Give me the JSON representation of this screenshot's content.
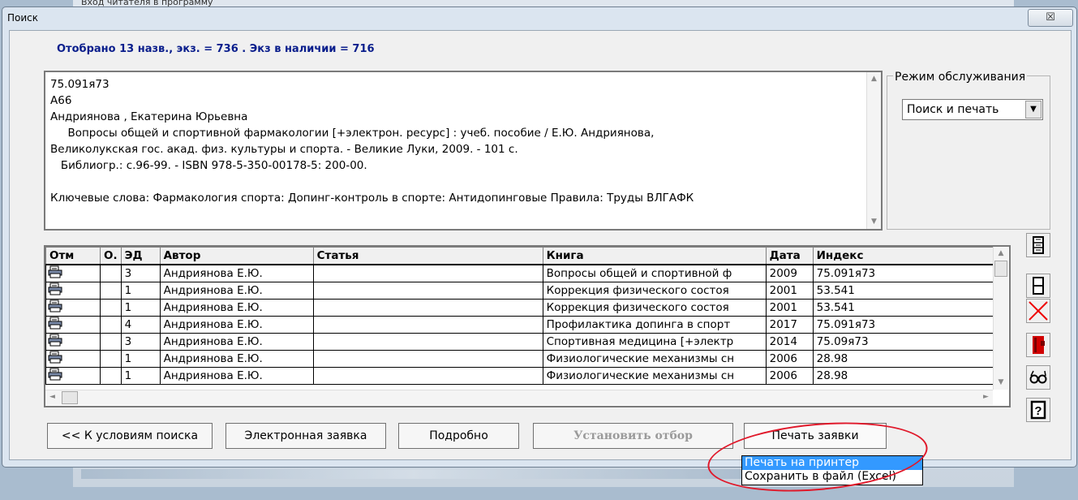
{
  "background_window": {
    "title": "Вход читателя в программу"
  },
  "window": {
    "title": "Поиск",
    "close_glyph": "☒"
  },
  "summary": "Отобрано 13 назв.,  экз. = 736 . Экз в наличии = 716",
  "description": {
    "lines": [
      "75.091я73",
      "А66",
      "Андриянова , Екатерина Юрьевна",
      "     Вопросы общей и спортивной фармакологии [+электрон. ресурс] : учеб. пособие / Е.Ю. Андриянова,",
      "Великолукская гос. акад. физ. культуры и спорта. - Великие Луки, 2009. - 101 с.",
      "   Библиогр.: с.96-99. - ISBN 978-5-350-00178-5: 200-00.",
      "",
      "Ключевые слова: Фармакология спорта: Допинг-контроль в спорте: Антидопинговые Правила: Труды ВЛГАФК"
    ]
  },
  "service_mode": {
    "label": "Режим обслуживания",
    "value": "Поиск и печать"
  },
  "grid": {
    "headers": [
      "Отм",
      "О.",
      "ЭД",
      "Автор",
      "Статья",
      "Книга",
      "Дата",
      "Индекс"
    ],
    "rows": [
      {
        "ed": "3",
        "author": "Андриянова Е.Ю.",
        "article": "",
        "book": "Вопросы общей и спортивной ф",
        "date": "2009",
        "index": "75.091я73"
      },
      {
        "ed": "1",
        "author": "Андриянова Е.Ю.",
        "article": "",
        "book": "Коррекция физического состоя",
        "date": "2001",
        "index": "53.541"
      },
      {
        "ed": "1",
        "author": "Андриянова Е.Ю.",
        "article": "",
        "book": "Коррекция физического состоя",
        "date": "2001",
        "index": "53.541"
      },
      {
        "ed": "4",
        "author": "Андриянова Е.Ю.",
        "article": "",
        "book": "Профилактика допинга в спорт",
        "date": "2017",
        "index": "75.091я73"
      },
      {
        "ed": "3",
        "author": "Андриянова Е.Ю.",
        "article": "",
        "book": "Спортивная медицина [+электр",
        "date": "2014",
        "index": "75.09я73"
      },
      {
        "ed": "1",
        "author": "Андриянова Е.Ю.",
        "article": "",
        "book": "Физиологические механизмы сн",
        "date": "2006",
        "index": "28.98"
      },
      {
        "ed": "1",
        "author": "Андриянова Е.Ю.",
        "article": "",
        "book": "Физиологические механизмы сн",
        "date": "2006",
        "index": "28.98"
      }
    ]
  },
  "buttons": {
    "back": "<< К условиям поиска",
    "electronic_request": "Электронная заявка",
    "details": "Подробно",
    "set_filter": "Установить отбор",
    "print_request": "Печать заявки"
  },
  "menu": {
    "print_to_printer": "Печать на принтер",
    "save_to_file": "Сохранить в файл (Excel)"
  },
  "icons": {
    "printer": "printer-icon",
    "tools": [
      "expand-rows-icon",
      "collapse-rows-icon",
      "delete-x-icon",
      "book-red-icon",
      "glasses-icon",
      "help-icon"
    ]
  },
  "colors": {
    "summary_text": "#0a1e8c",
    "highlight_ellipse": "#e0182a",
    "menu_selection": "#3399ff"
  }
}
